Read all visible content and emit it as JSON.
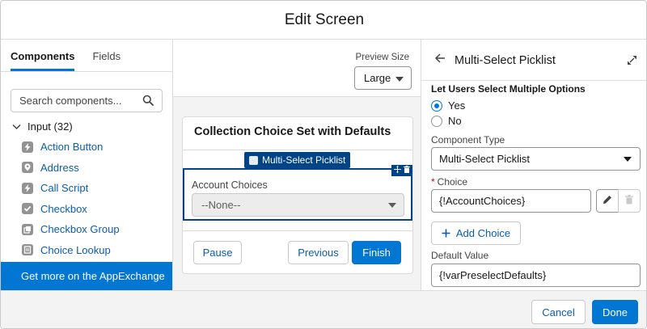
{
  "modal": {
    "title": "Edit Screen"
  },
  "left": {
    "tabs": [
      "Components",
      "Fields"
    ],
    "search_placeholder": "Search components...",
    "group_label": "Input (32)",
    "components": [
      {
        "label": "Action Button",
        "icon": "bolt-icon"
      },
      {
        "label": "Address",
        "icon": "location-pin-icon"
      },
      {
        "label": "Call Script",
        "icon": "bolt-icon"
      },
      {
        "label": "Checkbox",
        "icon": "checkbox-icon"
      },
      {
        "label": "Checkbox Group",
        "icon": "checkbox-group-icon"
      },
      {
        "label": "Choice Lookup",
        "icon": "lookup-icon"
      }
    ],
    "appexchange": "Get more on the AppExchange"
  },
  "center": {
    "preview_label": "Preview Size",
    "preview_value": "Large",
    "card_title": "Collection Choice Set with Defaults",
    "badge": "Multi-Select Picklist",
    "field_label": "Account Choices",
    "field_value": "--None--",
    "buttons": {
      "pause": "Pause",
      "previous": "Previous",
      "finish": "Finish"
    }
  },
  "right": {
    "title": "Multi-Select Picklist",
    "question": "Let Users Select Multiple Options",
    "radio_yes": "Yes",
    "radio_no": "No",
    "component_type_label": "Component Type",
    "component_type_value": "Multi-Select Picklist",
    "choice_label": "Choice",
    "choice_value": "{!AccountChoices}",
    "add_choice": "Add Choice",
    "default_label": "Default Value",
    "default_value": "{!varPreselectDefaults}"
  },
  "footer": {
    "cancel": "Cancel",
    "done": "Done"
  },
  "colors": {
    "brand": "#0176d3",
    "dark_brand": "#014486",
    "link": "#0b5cab",
    "required": "#ba0517"
  }
}
